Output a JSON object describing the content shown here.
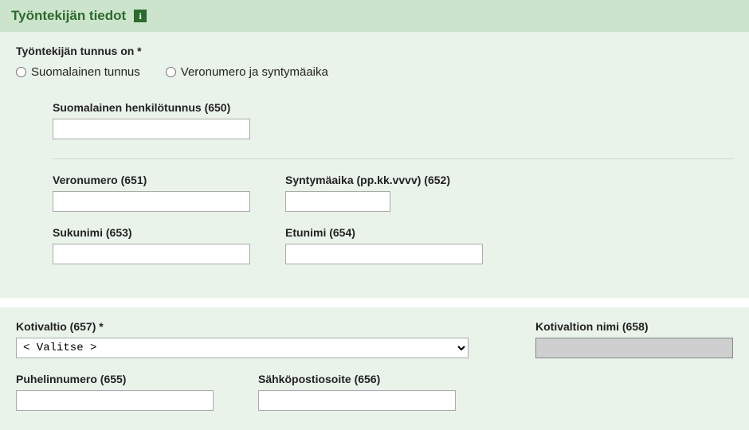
{
  "header": {
    "title": "Työntekijän tiedot",
    "info_icon_name": "info-icon"
  },
  "section1": {
    "group_label": "Työntekijän tunnus on *",
    "radio": {
      "opt1": "Suomalainen tunnus",
      "opt2": "Veronumero ja syntymäaika"
    },
    "fields": {
      "ssn_label": "Suomalainen henkilötunnus (650)",
      "ssn_value": "",
      "taxno_label": "Veronumero (651)",
      "taxno_value": "",
      "dob_label": "Syntymäaika (pp.kk.vvvv) (652)",
      "dob_value": "",
      "lastname_label": "Sukunimi (653)",
      "lastname_value": "",
      "firstname_label": "Etunimi (654)",
      "firstname_value": ""
    }
  },
  "section2": {
    "country_label": "Kotivaltio (657) *",
    "country_selected": "< Valitse >",
    "country_name_label": "Kotivaltion nimi (658)",
    "country_name_value": "",
    "phone_label": "Puhelinnumero (655)",
    "phone_value": "",
    "email_label": "Sähköpostiosoite (656)",
    "email_value": ""
  }
}
